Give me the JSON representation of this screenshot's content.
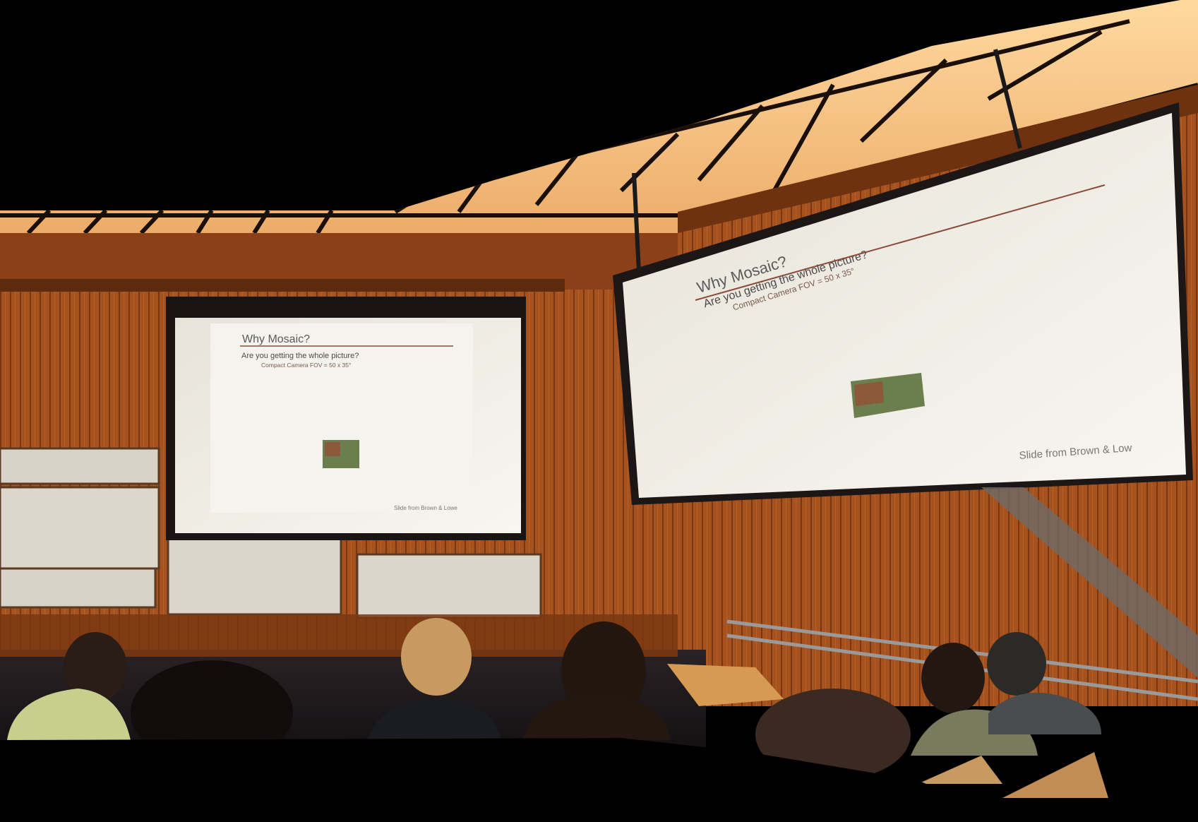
{
  "scene": {
    "description_type": "panorama-lecture-hall",
    "colors": {
      "background": "#000000",
      "wood": "#9a4a1c",
      "wood_dark": "#6b2f0e",
      "ceiling": "#f2b774",
      "screen": "#efede6",
      "slide_rule": "#8b4a3a",
      "slide_title": "#5a5a5a"
    }
  },
  "slide_left": {
    "title": "Why Mosaic?",
    "question": "Are you getting the whole picture?",
    "bullet": "Compact Camera FOV = 50 x 35°",
    "credit": "Slide from Brown & Lowe"
  },
  "slide_right": {
    "title": "Why Mosaic?",
    "question": "Are you getting the whole picture?",
    "bullet": "Compact Camera FOV = 50 x 35°",
    "credit": "Slide from Brown & Low"
  }
}
